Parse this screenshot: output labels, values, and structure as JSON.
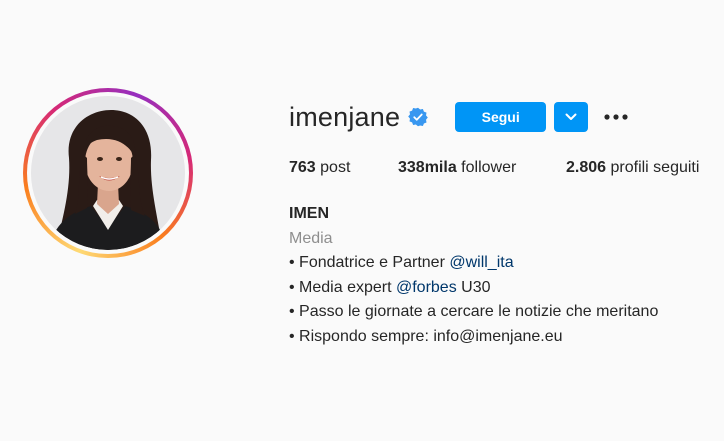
{
  "profile": {
    "username": "imenjane",
    "verified_icon": "verified-badge-icon",
    "accent_color": "#0095f6"
  },
  "actions": {
    "follow_label": "Segui",
    "dropdown_icon": "chevron-down-icon",
    "more_icon": "more-options-icon"
  },
  "stats": {
    "posts_count": "763",
    "posts_label": "post",
    "followers_count": "338mila",
    "followers_label": "follower",
    "following_count": "2.806",
    "following_label": "profili seguiti"
  },
  "bio": {
    "name": "IMEN",
    "category": "Media",
    "line1_text": "• Fondatrice e Partner ",
    "line1_link": "@will_ita",
    "line2_text": "• Media expert ",
    "line2_link": "@forbes",
    "line2_suffix": " U30",
    "line3": "• Passo le giornate a cercare le notizie che meritano",
    "line4": "• Rispondo sempre: info@imenjane.eu"
  }
}
